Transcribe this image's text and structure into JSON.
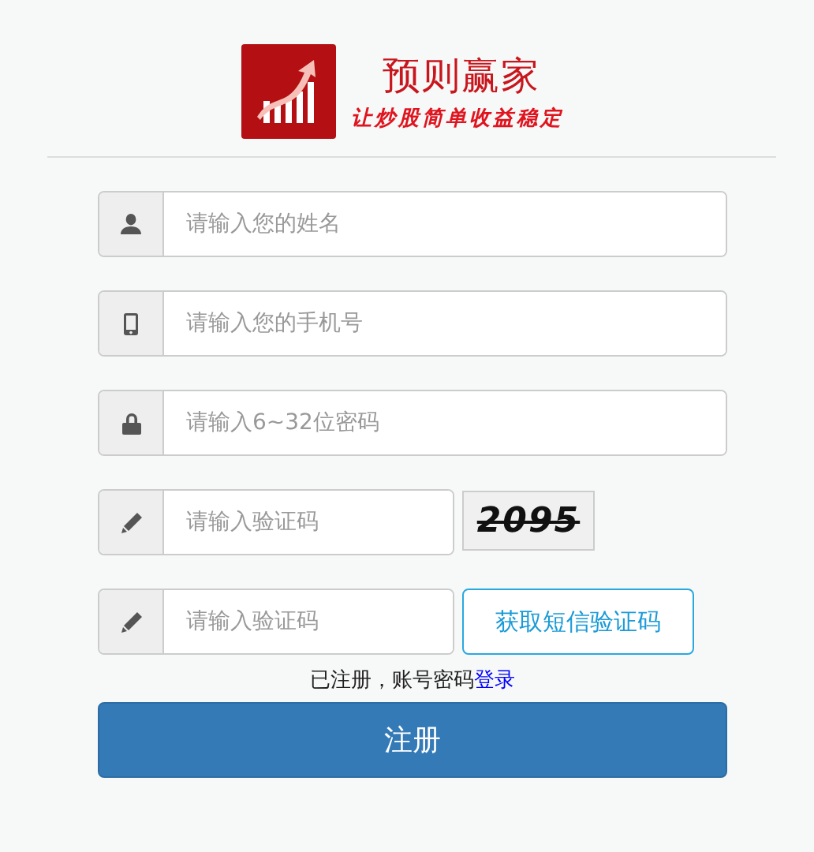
{
  "logo": {
    "title": "预则赢家",
    "slogan": "让炒股简单收益稳定"
  },
  "fields": [
    {
      "kind": "user",
      "placeholder": "请输入您的姓名"
    },
    {
      "kind": "phone",
      "placeholder": "请输入您的手机号"
    },
    {
      "kind": "lock",
      "placeholder": "请输入6~32位密码"
    },
    {
      "kind": "captcha",
      "placeholder": "请输入验证码",
      "captcha": "2095"
    },
    {
      "kind": "sms",
      "placeholder": "请输入验证码",
      "button": "获取短信验证码"
    }
  ],
  "login_hint": {
    "text": "已注册，账号密码",
    "link": "登录"
  },
  "submit": "注册"
}
